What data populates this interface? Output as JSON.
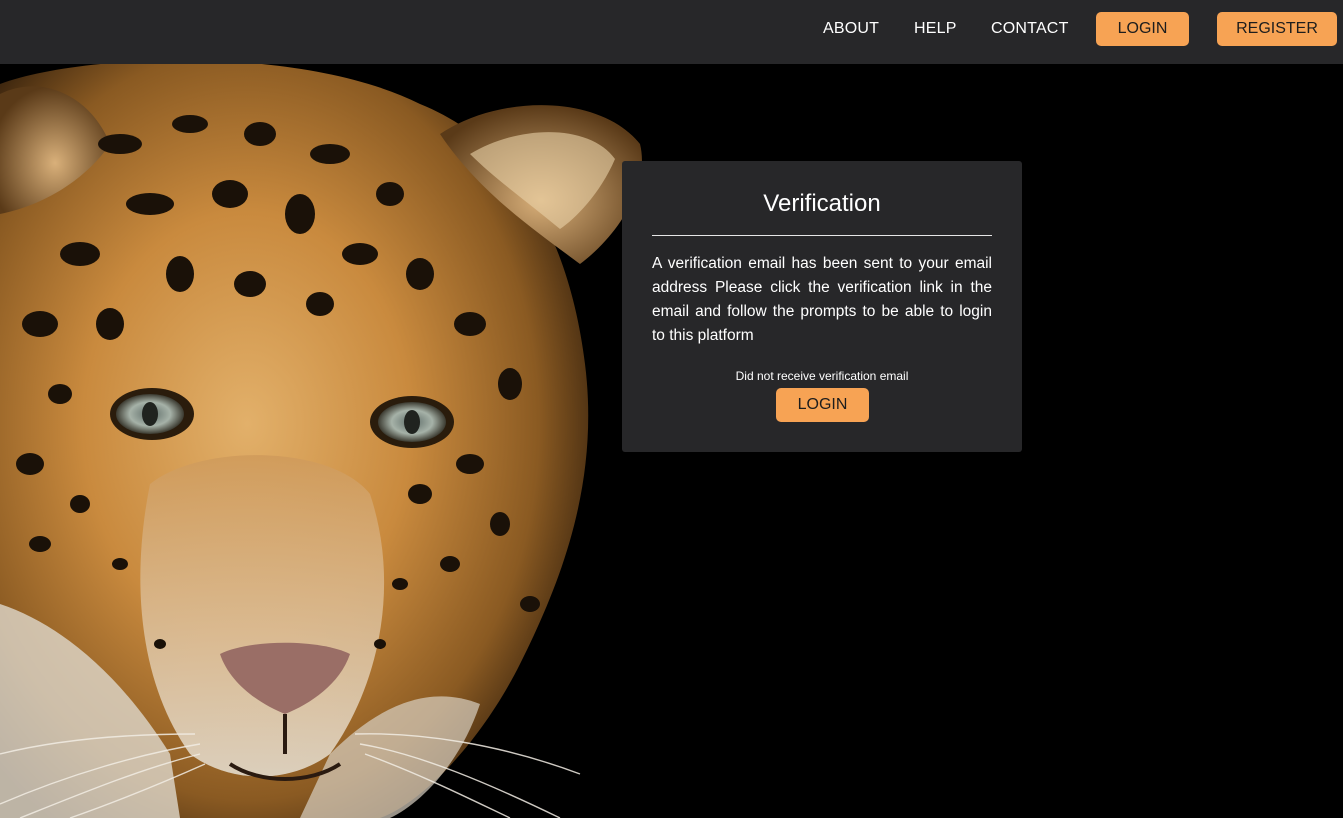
{
  "navbar": {
    "links": [
      "ABOUT",
      "HELP",
      "CONTACT"
    ],
    "login_label": "LOGIN",
    "register_label": "REGISTER",
    "background": "#272729",
    "accent": "#f7a354"
  },
  "hero": {
    "image": "leopard-face-photo",
    "background": "#000000"
  },
  "verification_card": {
    "title": "Verification",
    "message": "A verification email has been sent to your email address Please click the verification link in the email and follow the prompts to be able to login to this platform",
    "note": "Did not receive verification email",
    "button_label": "LOGIN",
    "background": "#272729"
  }
}
